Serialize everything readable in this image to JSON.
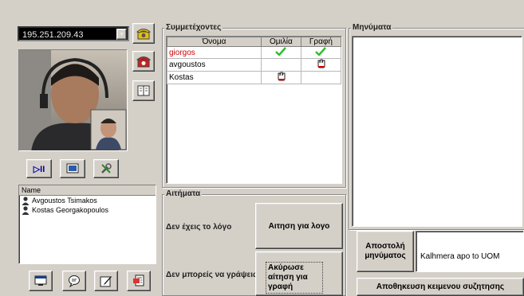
{
  "ip_combo": {
    "value": "195.251.209.43"
  },
  "users_list": {
    "header": "Name",
    "items": [
      "Avgoustos Tsimakos",
      "Kostas Georgakopoulos"
    ]
  },
  "participants": {
    "title": "Συμμετέχοντες",
    "columns": [
      "Όνομα",
      "Ομιλία",
      "Γραφή"
    ],
    "rows": [
      {
        "name": "giorgos",
        "name_color": "#cc0000",
        "speak": "check-icon",
        "write": "check-icon"
      },
      {
        "name": "avgoustos",
        "name_color": "#000000",
        "speak": "",
        "write": "hand-icon"
      },
      {
        "name": "Kostas",
        "name_color": "#000000",
        "speak": "hand-icon",
        "write": ""
      }
    ]
  },
  "requests": {
    "title": "Αιτήματα",
    "speak_status": "Δεν έχεις το λόγο",
    "speak_button": "Αιτηση για λογο",
    "write_status": "Δεν μπορείς να γράψεις",
    "write_button": "Ακύρωσε αίτηση για γραφή"
  },
  "messages": {
    "title": "Μηνύματα",
    "send_button": "Αποστολή μηνύματος",
    "input_value": "Kalhmera apo to UOM",
    "save_button": "Αποθηκευση κειμενου συζητησης"
  },
  "colors": {
    "check": "#2fbf2f",
    "hand_red": "#cc0000"
  }
}
